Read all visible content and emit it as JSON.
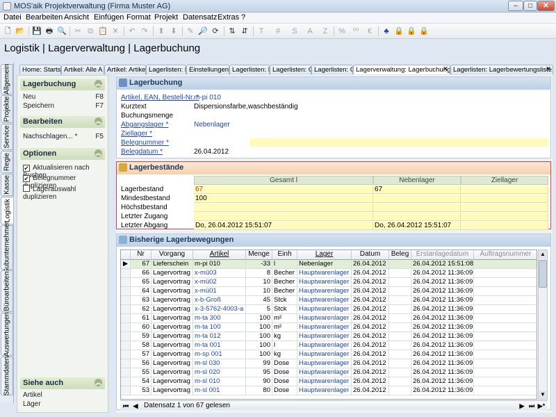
{
  "window": {
    "title": "MOS'aik Projektverwaltung (Firma Muster AG)"
  },
  "menu": [
    "Datei",
    "Bearbeiten",
    "Ansicht",
    "Einfügen",
    "Format",
    "Projekt",
    "Datensatz",
    "Extras",
    "?"
  ],
  "breadcrumb": "Logistik | Lagerverwaltung | Lagerbuchung",
  "vertical_tabs": [
    "Allgemein",
    "Projekte",
    "Service",
    "Regie",
    "Kasse",
    "Logistik",
    "Subunternehmer",
    "Büroarbeiten",
    "Auswertungen",
    "Stammdaten"
  ],
  "doc_tabs": [
    "Home: Starts",
    "Artikel: Alle A",
    "Artikel: Artikel",
    "Lagerlisten: L",
    "Einstellungen:",
    "Lagerlisten: L",
    "Lagerlisten: G",
    "Lagerlisten: G",
    "Lagerverwaltung: Lagerbuchung",
    "Lagerlisten: Lagerbewertungsliste"
  ],
  "sidebar": {
    "lagerbuchung": {
      "title": "Lagerbuchung",
      "items": [
        {
          "label": "Neu",
          "key": "F8"
        },
        {
          "label": "Speichern",
          "key": "F7"
        }
      ]
    },
    "bearbeiten": {
      "title": "Bearbeiten",
      "items": [
        {
          "label": "Nachschlagen... *",
          "key": "F5"
        }
      ]
    },
    "optionen": {
      "title": "Optionen",
      "items": [
        {
          "label": "Aktualisieren nach Buchen",
          "checked": true
        },
        {
          "label": "Belegnummer duplizieren",
          "checked": true
        },
        {
          "label": "Lagerauswahl duplizieren",
          "checked": false
        }
      ]
    },
    "siehe_auch": {
      "title": "Siehe auch",
      "items": [
        "Artikel",
        "Läger"
      ]
    }
  },
  "lagerbuchung": {
    "title": "Lagerbuchung",
    "fields": [
      {
        "label": "Artikel, EAN, Bestell-Nr. *",
        "value": "m-pi 010",
        "link": true
      },
      {
        "label": "Kurztext",
        "value": "Dispersionsfarbe,waschbeständig",
        "link": false
      },
      {
        "label": "Buchungsmenge",
        "value": "",
        "link": false
      },
      {
        "label": "Abgangslager *",
        "value": "Nebenlager",
        "link": true
      },
      {
        "label": "Ziellager *",
        "value": "",
        "link": true
      },
      {
        "label": "Belegnummer *",
        "value": "",
        "link": true
      },
      {
        "label": "Belegdatum *",
        "value": "26.04.2012",
        "link": true
      }
    ]
  },
  "lagerbestaende": {
    "title": "Lagerbestände",
    "columns": [
      "Gesamt l",
      "Nebenlager",
      "Ziellager"
    ],
    "rows": [
      {
        "label": "Lagerbestand",
        "values": [
          "67",
          "67",
          ""
        ]
      },
      {
        "label": "Mindestbestand",
        "values": [
          "100",
          "",
          ""
        ]
      },
      {
        "label": "Höchstbestand",
        "values": [
          "",
          "",
          ""
        ]
      },
      {
        "label": "Letzter Zugang",
        "values": [
          "",
          "",
          ""
        ]
      },
      {
        "label": "Letzter Abgang",
        "values": [
          "Do, 26.04.2012 15:51:07",
          "Do, 26.04.2012 15:51:07",
          ""
        ]
      }
    ]
  },
  "bewegungen": {
    "title": "Bisherige Lagerbewegungen",
    "columns": [
      "Nr",
      "Vorgang",
      "Artikel",
      "Menge",
      "Einh",
      "Lager",
      "Datum",
      "Beleg",
      "Erstanlagedatum",
      "Auftragsnummer"
    ],
    "rows": [
      [
        "67",
        "Lieferschein",
        "m-pi 010",
        "-33",
        "l",
        "Nebenlager",
        "26.04.2012",
        "",
        "26.04.2012 15:51:08",
        ""
      ],
      [
        "66",
        "Lagervortrag",
        "x-mü03",
        "8",
        "Becher",
        "Hauptwarenlager",
        "26.04.2012",
        "",
        "26.04.2012 11:36:09",
        ""
      ],
      [
        "65",
        "Lagervortrag",
        "x-mü02",
        "10",
        "Becher",
        "Hauptwarenlager",
        "26.04.2012",
        "",
        "26.04.2012 11:36:09",
        ""
      ],
      [
        "64",
        "Lagervortrag",
        "x-mü01",
        "10",
        "Becher",
        "Hauptwarenlager",
        "26.04.2012",
        "",
        "26.04.2012 11:36:09",
        ""
      ],
      [
        "63",
        "Lagervortrag",
        "x-b-Groß",
        "45",
        "Stck",
        "Hauptwarenlager",
        "26.04.2012",
        "",
        "26.04.2012 11:36:09",
        ""
      ],
      [
        "62",
        "Lagervortrag",
        "x-3-5762-4003-a",
        "5",
        "Stck",
        "Hauptwarenlager",
        "26.04.2012",
        "",
        "26.04.2012 11:36:09",
        ""
      ],
      [
        "61",
        "Lagervortrag",
        "m-ta 300",
        "100",
        "m²",
        "Hauptwarenlager",
        "26.04.2012",
        "",
        "26.04.2012 11:36:09",
        ""
      ],
      [
        "60",
        "Lagervortrag",
        "m-ta 100",
        "100",
        "m²",
        "Hauptwarenlager",
        "26.04.2012",
        "",
        "26.04.2012 11:36:09",
        ""
      ],
      [
        "59",
        "Lagervortrag",
        "m-ta 012",
        "100",
        "kg",
        "Hauptwarenlager",
        "26.04.2012",
        "",
        "26.04.2012 11:36:09",
        ""
      ],
      [
        "58",
        "Lagervortrag",
        "m-ta 001",
        "100",
        "l",
        "Hauptwarenlager",
        "26.04.2012",
        "",
        "26.04.2012 11:36:09",
        ""
      ],
      [
        "57",
        "Lagervortrag",
        "m-sp 001",
        "100",
        "kg",
        "Hauptwarenlager",
        "26.04.2012",
        "",
        "26.04.2012 11:36:09",
        ""
      ],
      [
        "56",
        "Lagervortrag",
        "m-sl 030",
        "99",
        "Dose",
        "Hauptwarenlager",
        "26.04.2012",
        "",
        "26.04.2012 11:36:09",
        ""
      ],
      [
        "55",
        "Lagervortrag",
        "m-sl 020",
        "95",
        "Dose",
        "Hauptwarenlager",
        "26.04.2012",
        "",
        "26.04.2012 11:36:09",
        ""
      ],
      [
        "54",
        "Lagervortrag",
        "m-sl 010",
        "90",
        "Dose",
        "Hauptwarenlager",
        "26.04.2012",
        "",
        "26.04.2012 11:36:09",
        ""
      ],
      [
        "53",
        "Lagervortrag",
        "m-sl 001",
        "80",
        "Dose",
        "Hauptwarenlager",
        "26.04.2012",
        "",
        "26.04.2012 11:36:09",
        ""
      ]
    ],
    "record_status": "Datensatz 1 von 67 gelesen"
  }
}
